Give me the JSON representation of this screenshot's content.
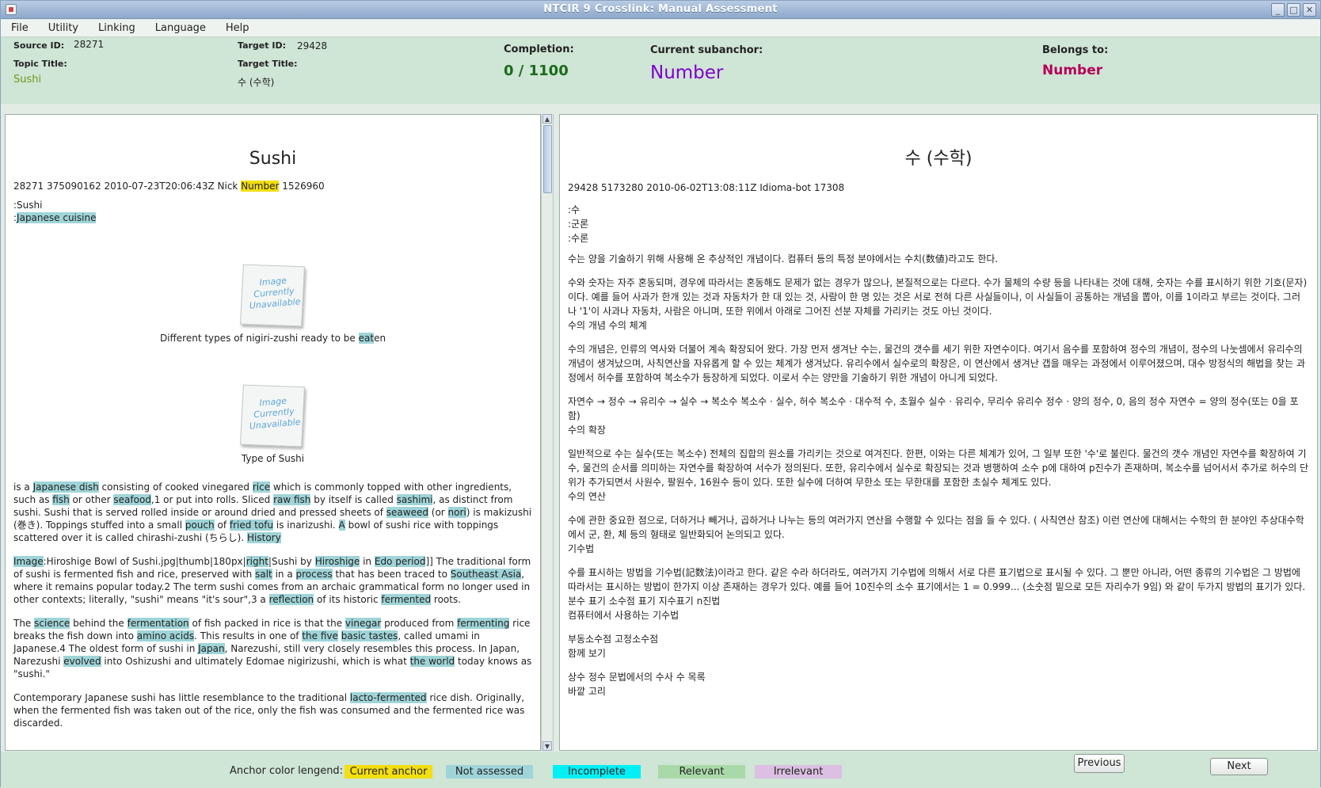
{
  "window": {
    "title": "NTCIR 9 Crosslink: Manual Assessment",
    "controls": [
      "_",
      "□",
      "✕"
    ]
  },
  "menu": [
    "File",
    "Utility",
    "Linking",
    "Language",
    "Help"
  ],
  "info": {
    "source_id_label": "Source ID:",
    "source_id": "28271",
    "target_id_label": "Target ID:",
    "target_id": "29428",
    "topic_title_label": "Topic Title:",
    "topic_title": "Sushi",
    "target_title_label": "Target Title:",
    "target_title": "수 (수학)",
    "completion_label": "Completion:",
    "completion": "0 / 1100",
    "subanchor_label": "Current subanchor:",
    "subanchor": "Number",
    "belongs_label": "Belongs to:",
    "belongs": "Number"
  },
  "colors": {
    "current": "#f3de10",
    "not_assessed": "#9fd4d8",
    "incomplete": "#00f0f6",
    "relevant": "#a9d9a9",
    "irrelevant": "#dcbfe2",
    "subanchor": "#7f00cc",
    "belongs": "#b4005a",
    "completion": "#1a6b1a",
    "topic": "#6e9a1a"
  },
  "left_doc": {
    "title": "Sushi",
    "meta_pre": "28271 375090162 2010-07-23T20:06:43Z Nick ",
    "meta_anchor": "Number",
    "meta_post": " 1526960",
    "line1": ":Sushi",
    "line2_pre": ":",
    "line2_anchor": "Japanese cuisine",
    "image_placeholder": "Image Currently Unavailable",
    "caption1_pre": "Different types of nigiri-zushi ready to be ",
    "caption1_anchor": "eat",
    "caption1_post": "en",
    "caption2": "Type of Sushi",
    "paragraphs": [
      [
        [
          "is a ",
          0
        ],
        [
          "Japanese dish",
          1
        ],
        [
          " consisting of cooked vinegared ",
          0
        ],
        [
          "rice",
          1
        ],
        [
          " which is commonly topped with other ingredients, such as ",
          0
        ],
        [
          "fish",
          1
        ],
        [
          " or other ",
          0
        ],
        [
          "seafood",
          1
        ],
        [
          ",1 or put into rolls. Sliced ",
          0
        ],
        [
          "raw fish",
          1
        ],
        [
          " by itself is called ",
          0
        ],
        [
          "sashimi",
          1
        ],
        [
          ", as distinct from sushi. Sushi that is served rolled inside or around dried and pressed sheets of ",
          0
        ],
        [
          "seaweed",
          1
        ],
        [
          " (or ",
          0
        ],
        [
          "nori",
          1
        ],
        [
          ") is makizushi (巻き). Toppings stuffed into a small ",
          0
        ],
        [
          "pouch",
          1
        ],
        [
          " of ",
          0
        ],
        [
          "fried tofu",
          1
        ],
        [
          " is inarizushi. ",
          0
        ],
        [
          "A",
          1
        ],
        [
          " bowl of sushi rice with toppings scattered over it is called chirashi-zushi (ちらし). ",
          0
        ],
        [
          "History",
          1
        ]
      ],
      [
        [
          "Image",
          1
        ],
        [
          ":Hiroshige Bowl of Sushi.jpg|thumb|180px|",
          0
        ],
        [
          "right",
          1
        ],
        [
          "|Sushi by ",
          0
        ],
        [
          "Hiroshige",
          1
        ],
        [
          " in ",
          0
        ],
        [
          "Edo period",
          1
        ],
        [
          "]] The traditional form of sushi is fermented fish and rice, preserved with ",
          0
        ],
        [
          "salt",
          1
        ],
        [
          " in a ",
          0
        ],
        [
          "process",
          1
        ],
        [
          " that has been traced to ",
          0
        ],
        [
          "Southeast Asia",
          1
        ],
        [
          ", where it remains popular today.2 The term sushi comes from an archaic grammatical form no longer used in other contexts; literally, \"sushi\" means \"it's sour\",3 a ",
          0
        ],
        [
          "reflection",
          1
        ],
        [
          " of its historic ",
          0
        ],
        [
          "fermented",
          1
        ],
        [
          " roots.",
          0
        ]
      ],
      [
        [
          "The ",
          0
        ],
        [
          "science",
          1
        ],
        [
          " behind the ",
          0
        ],
        [
          "fermentation",
          1
        ],
        [
          " of fish packed in rice is that the ",
          0
        ],
        [
          "vinegar",
          1
        ],
        [
          " produced from ",
          0
        ],
        [
          "fermenting",
          1
        ],
        [
          " rice breaks the fish down into ",
          0
        ],
        [
          "amino acids",
          1
        ],
        [
          ". This results in one of ",
          0
        ],
        [
          "the five",
          1
        ],
        [
          " ",
          0
        ],
        [
          "basic tastes",
          1
        ],
        [
          ", called umami in Japanese.4 The oldest form of sushi in ",
          0
        ],
        [
          "Japan",
          1
        ],
        [
          ", Narezushi, still very closely resembles this process. In Japan, Narezushi ",
          0
        ],
        [
          "evolved",
          1
        ],
        [
          " into Oshizushi and ultimately Edomae nigirizushi, which is what ",
          0
        ],
        [
          "the world",
          1
        ],
        [
          " today knows as \"sushi.\"",
          0
        ]
      ],
      [
        [
          "Contemporary Japanese sushi has little resemblance to the traditional ",
          0
        ],
        [
          "lacto-fermented",
          1
        ],
        [
          " rice dish. Originally, when the fermented fish was taken out of the rice, only the fish was consumed and the fermented rice was discarded.",
          0
        ]
      ]
    ]
  },
  "right_doc": {
    "title": "수 (수학)",
    "meta": "29428 5173280 2010-06-02T13:08:11Z Idioma-bot 17308",
    "lines_top": [
      ":수",
      ":군론",
      ":수론"
    ],
    "blocks": [
      [
        "수는 양을 기술하기 위해 사용해 온 추상적인 개념이다. 컴퓨터 등의 특정 분야에서는 수치(数値)라고도 한다."
      ],
      [
        "수와 숫자는 자주 혼동되며, 경우에 따라서는 혼동해도 문제가 없는 경우가 많으나, 본질적으로는 다르다. 수가 물체의 수량 등을 나타내는 것에 대해, 숫자는 수를 표시하기 위한 기호(문자)이다. 예를 들어 사과가 한개 있는 것과 자동차가 한 대 있는 것, 사람이 한 명 있는 것은 서로 전혀 다른 사실들이나, 이 사실들이 공통하는 개념을 뽑아, 이를 1이라고 부르는 것이다. 그러나 '1'이 사과나 자동차, 사람은 아니며, 또한 위에서 아래로 그어진 선분 자체를 가리키는 것도 아닌 것이다.",
        "수의 개념 수의 체계"
      ],
      [
        "수의 개념은, 인류의 역사와 더불어 계속 확장되어 왔다. 가장 먼저 생겨난 수는, 물건의 갯수를 세기 위한 자연수이다. 여기서 음수를 포함하여 정수의 개념이, 정수의 나눗셈에서 유리수의 개념이 생겨났으며, 사칙연산을 자유롭게 할 수 있는 체계가 생겨났다. 유리수에서 실수로의 확장은, 이 연산에서 생겨난 갭을 매우는 과정에서 이루어졌으며, 대수 방정식의 해법을 찾는 과정에서 허수를 포함하여 복소수가 등장하게 되었다. 이로서 수는 양만을 기술하기 위한 개념이 아니게 되었다."
      ],
      [
        "자연수 → 정수 → 유리수 → 실수 → 복소수 복소수 · 실수, 허수 복소수 · 대수적 수, 초월수 실수 · 유리수, 무리수 유리수 정수 · 양의 정수, 0, 음의 정수 자연수 = 양의 정수(또는 0을 포함)",
        "수의 확장"
      ],
      [
        "일반적으로 수는 실수(또는 복소수) 전체의 집합의 원소를 가리키는 것으로 여겨진다. 한편, 이와는 다른 체계가 있어, 그 일부 또한 '수'로 불린다. 물건의 갯수 개념인 자연수를 확장하여 기수, 물건의 순서를 의미하는 자연수를 확장하여 서수가 정의된다. 또한, 유리수에서 실수로 확장되는 것과 병행하여 소수 p에 대하여 p진수가 존재하며, 복소수를 넘어서서 추가로 허수의 단위가 추가되면서 사원수, 팔원수, 16원수 등이 있다. 또한 실수에 더하여 무한소 또는 무한대를 포함한 초실수 체계도 있다.",
        "수의 연산"
      ],
      [
        "수에 관한 중요한 점으로, 더하거나 빼거나, 곱하거나 나누는 등의 여러가지 연산을 수행할 수 있다는 점을 들 수 있다. ( 사칙연산 참조) 이런 연산에 대해서는 수학의 한 분야인 추상대수학에서 군, 환, 체 등의 형태로 일반화되어 논의되고 있다.",
        "기수법"
      ],
      [
        "수를 표시하는 방법을 기수법(記数法)이라고 한다. 같은 수라 하더라도, 여러가지 기수법에 의해서 서로 다른 표기법으로 표시될 수 있다. 그 뿐만 아니라, 어떤 종류의 기수법은 그 방법에 따라서는 표시하는 방법이 한가지 이상 존재하는 경우가 있다. 예를 들어 10진수의 소수 표기에서는 1 = 0.999... (소숫점 밑으로 모든 자리수가 9임) 와 같이 두가지 방법의 표기가 있다. 분수 표기 소수점 표기 지수표기 n진법",
        "컴퓨터에서 사용하는 기수법"
      ],
      [
        "부동소수점 고정소수점",
        "함께 보기"
      ],
      [
        "상수 정수 문법에서의 수사 수 목록",
        "바깥 고리"
      ]
    ]
  },
  "legend": {
    "label": "Anchor color lengend:",
    "current": "Current anchor",
    "not_assessed": "Not assessed",
    "incomplete": "Incomplete",
    "relevant": "Relevant",
    "irrelevant": "Irrelevant"
  },
  "buttons": {
    "previous": "Previous",
    "next": "Next"
  }
}
